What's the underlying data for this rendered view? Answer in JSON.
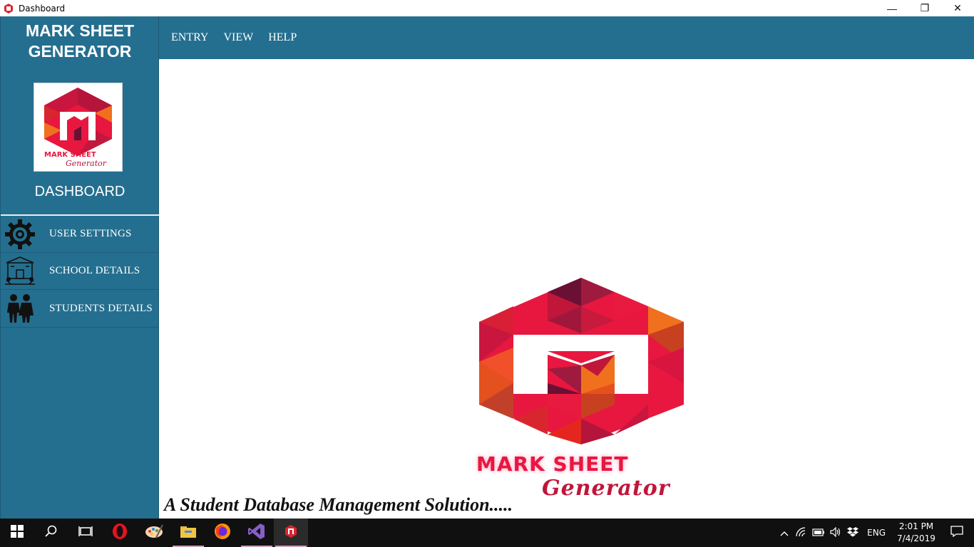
{
  "window": {
    "title": "Dashboard",
    "controls": {
      "minimize": "—",
      "restore": "❐",
      "close": "✕"
    }
  },
  "sidebar": {
    "brand_line1": "MARK SHEET",
    "brand_line2": "GENERATOR",
    "logo_text_top": "MARK SHEET",
    "logo_text_bottom": "Generator",
    "dashboard_label": "DASHBOARD",
    "items": [
      {
        "label": "USER SETTINGS",
        "icon": "gear-icon"
      },
      {
        "label": "SCHOOL DETAILS",
        "icon": "school-icon"
      },
      {
        "label": "STUDENTS DETAILS",
        "icon": "students-icon"
      }
    ]
  },
  "menu": {
    "items": [
      "ENTRY",
      "VIEW",
      "HELP"
    ]
  },
  "main": {
    "logo_text_top": "MARK SHEET",
    "logo_text_bottom": "Generator",
    "tagline": "A Student Database Management Solution....."
  },
  "taskbar": {
    "apps": [
      "windows-start-icon",
      "search-icon",
      "task-view-icon",
      "opera-icon",
      "paint-icon",
      "file-explorer-icon",
      "firefox-icon",
      "visual-studio-icon",
      "mark-sheet-app-icon"
    ],
    "language": "ENG",
    "time": "2:01 PM",
    "date": "7/4/2019"
  },
  "colors": {
    "sidebar": "#246f8f",
    "menubar": "#246f8f",
    "logo_red": "#e8173f",
    "logo_orange": "#f0701e",
    "logo_maroon": "#6a1034"
  }
}
